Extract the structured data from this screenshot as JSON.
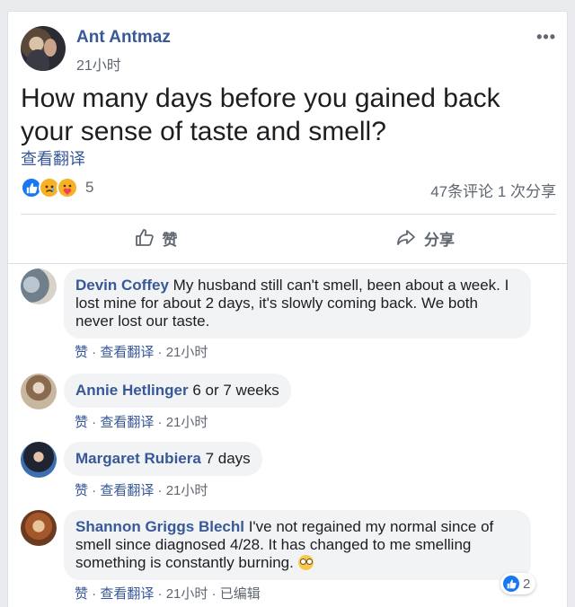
{
  "post": {
    "author": "Ant Antmaz",
    "time": "21小时",
    "more": "•••",
    "text": "How many days before you gained back your sense of taste and smell?",
    "see_translation": "查看翻译",
    "reaction_count": "5",
    "stats": "47条评论  1 次分享",
    "reactions": [
      "like",
      "sad",
      "care"
    ]
  },
  "actions": {
    "like_label": "赞",
    "share_label": "分享"
  },
  "comments": [
    {
      "name": "Devin Coffey",
      "text": "My husband still can't smell, been about a week. I lost mine for about 2 days, it's slowly coming back. We both never lost our taste.",
      "like": "赞",
      "translate": "查看翻译",
      "time": "21小时"
    },
    {
      "name": "Annie Hetlinger",
      "text": "6 or 7 weeks",
      "like": "赞",
      "translate": "查看翻译",
      "time": "21小时"
    },
    {
      "name": "Margaret Rubiera",
      "text": "7 days",
      "like": "赞",
      "translate": "查看翻译",
      "time": "21小时"
    },
    {
      "name": "Shannon Griggs Blechl",
      "text": "I've not regained my normal since of smell since diagnosed 4/28. It has changed to me smelling something is constantly burning.",
      "like": "赞",
      "translate": "查看翻译",
      "time": "21小时",
      "edited": "已编辑",
      "reaction_count": "2"
    }
  ],
  "colors": {
    "link": "#385898",
    "like_blue": "#1877f2",
    "bubble": "#f2f3f5",
    "meta": "#606770"
  }
}
